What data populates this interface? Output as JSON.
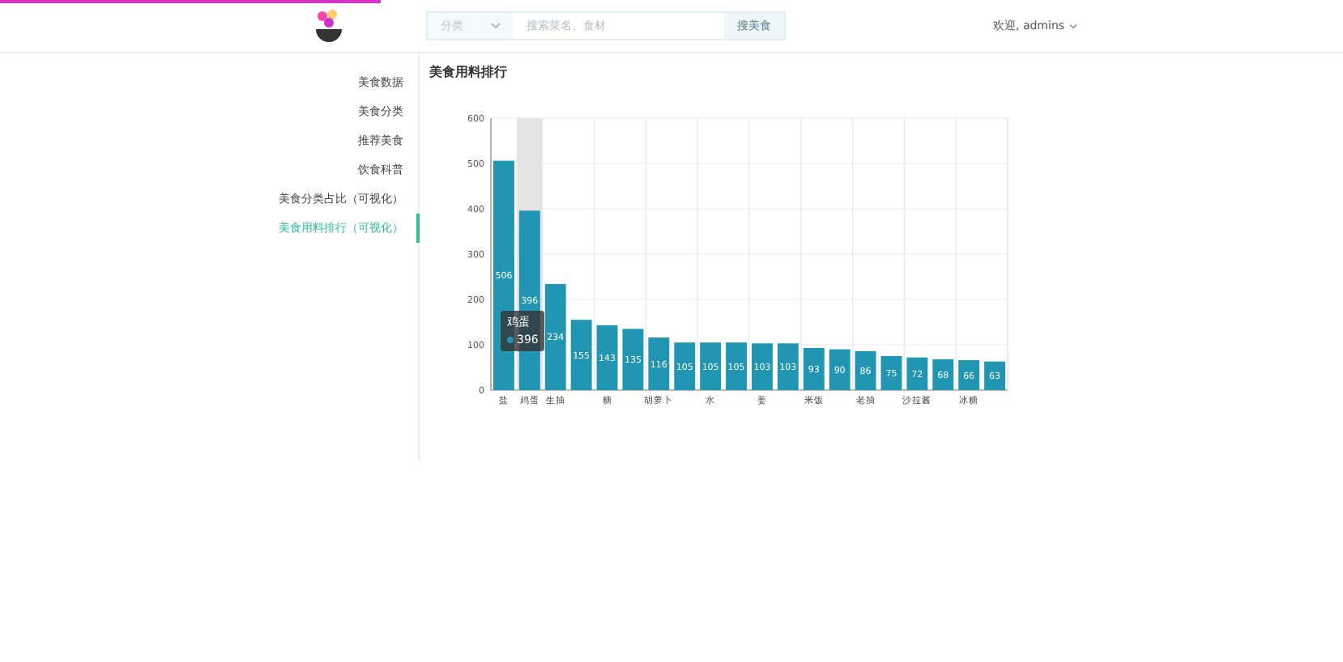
{
  "header": {
    "category_select": {
      "value": "分类"
    },
    "search": {
      "placeholder": "搜索菜名、食材"
    },
    "search_button": "搜美食",
    "welcome": "欢迎, admins"
  },
  "sidebar": {
    "items": [
      {
        "label": "美食数据",
        "selected": false
      },
      {
        "label": "美食分类",
        "selected": false
      },
      {
        "label": "推荐美食",
        "selected": false
      },
      {
        "label": "饮食科普",
        "selected": false
      },
      {
        "label": "美食分类占比（可视化）",
        "selected": false
      },
      {
        "label": "美食用料排行（可视化）",
        "selected": true
      }
    ]
  },
  "content": {
    "title": "美食用料排行",
    "chart_data": {
      "type": "bar",
      "categories": [
        "盐",
        "鸡蛋",
        "生抽",
        null,
        "糖",
        null,
        "胡萝卜",
        null,
        "水",
        null,
        "姜",
        null,
        "米饭",
        null,
        "老抽",
        null,
        "沙拉酱",
        null,
        "冰糖",
        null
      ],
      "series": [
        {
          "color": "#2196b3",
          "values": [
            506,
            396,
            234,
            155,
            143,
            135,
            116,
            105,
            105,
            105,
            103,
            103,
            93,
            90,
            86,
            75,
            72,
            68,
            66,
            63
          ]
        }
      ],
      "ylim": [
        0,
        600
      ],
      "yticks": [
        0,
        100,
        200,
        300,
        400,
        500,
        600
      ],
      "data_labels": true,
      "grid": true
    },
    "tooltip": {
      "title": "鸡蛋",
      "value": "396"
    }
  }
}
